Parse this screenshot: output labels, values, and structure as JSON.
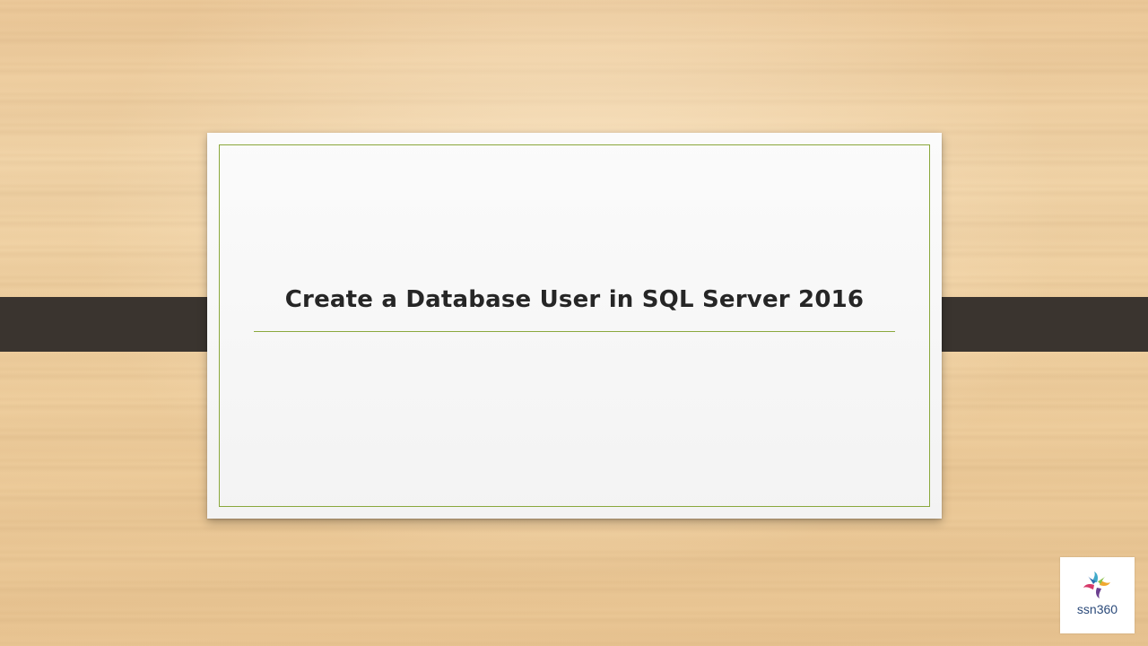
{
  "slide": {
    "title": "Create a Database User in SQL Server 2016"
  },
  "logo": {
    "text": "ssn360",
    "icon": "pinwheel-logo-icon"
  },
  "colors": {
    "accent_green": "#8aa83c",
    "band": "#3a342f",
    "title_text": "#262626",
    "logo_text": "#2b4a7a"
  }
}
